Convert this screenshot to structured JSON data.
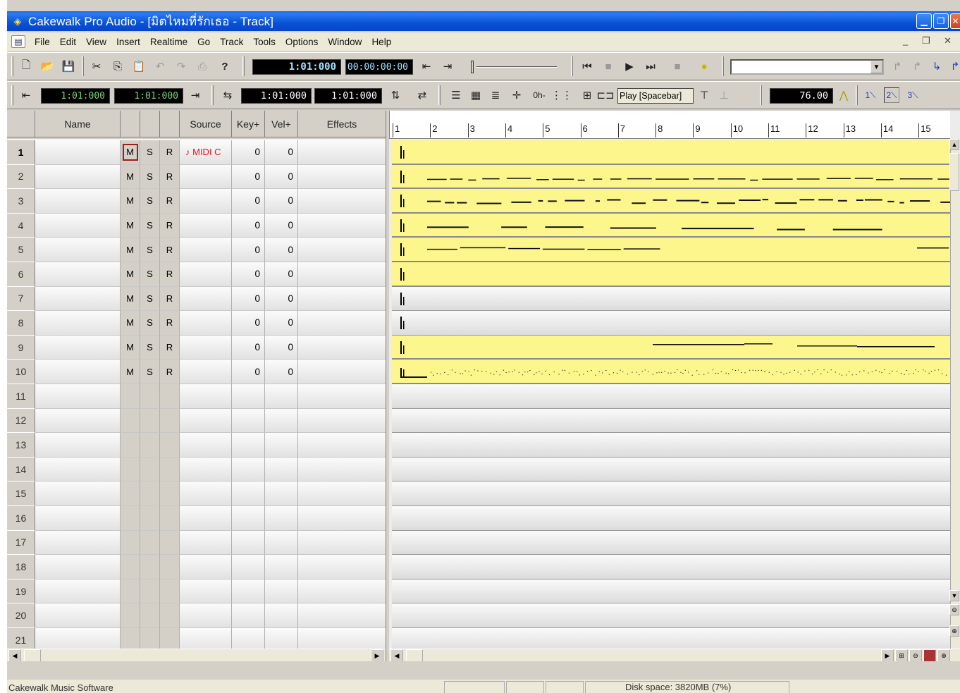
{
  "window": {
    "title": "Cakewalk Pro Audio - [มิตไหมที่รักเธอ - Track]",
    "app_icon": "cakewalk-icon",
    "controls": [
      "minimize",
      "restore",
      "close"
    ]
  },
  "menu": {
    "items": [
      "File",
      "Edit",
      "View",
      "Insert",
      "Realtime",
      "Go",
      "Track",
      "Tools",
      "Options",
      "Window",
      "Help"
    ],
    "mdi_controls": "_ ̅□ ×"
  },
  "toolbar1": {
    "now_time_mbt": "1:01:000",
    "now_time_smpte": "00:00:00:00",
    "combo_value": "",
    "icons": [
      "new-icon",
      "open-icon",
      "save-icon",
      "cut-icon",
      "copy-icon",
      "paste-icon",
      "undo-icon",
      "redo-icon",
      "print-icon",
      "help-icon",
      "rewind-to-start-icon",
      "stop-icon",
      "play-icon",
      "go-to-end-icon",
      "record-icon",
      "panic-icon"
    ]
  },
  "toolbar2": {
    "from_time": "1:01:000",
    "thru_time": "1:01:000",
    "loop_start": "1:01:000",
    "loop_end": "1:01:000",
    "play_label": "Play [Spacebar]",
    "tempo": "76.00",
    "meter_labels": [
      "1",
      "2",
      "3"
    ]
  },
  "columns": {
    "name": "Name",
    "source": "Source",
    "key": "Key+",
    "vel": "Vel+",
    "effects": "Effects"
  },
  "tracks": [
    {
      "num": "1",
      "m": "M",
      "s": "S",
      "r": "R",
      "source": "♪ MIDI C",
      "key": "0",
      "vel": "0"
    },
    {
      "num": "2",
      "m": "M",
      "s": "S",
      "r": "R",
      "source": "",
      "key": "0",
      "vel": "0"
    },
    {
      "num": "3",
      "m": "M",
      "s": "S",
      "r": "R",
      "source": "",
      "key": "0",
      "vel": "0"
    },
    {
      "num": "4",
      "m": "M",
      "s": "S",
      "r": "R",
      "source": "",
      "key": "0",
      "vel": "0"
    },
    {
      "num": "5",
      "m": "M",
      "s": "S",
      "r": "R",
      "source": "",
      "key": "0",
      "vel": "0"
    },
    {
      "num": "6",
      "m": "M",
      "s": "S",
      "r": "R",
      "source": "",
      "key": "0",
      "vel": "0"
    },
    {
      "num": "7",
      "m": "M",
      "s": "S",
      "r": "R",
      "source": "",
      "key": "0",
      "vel": "0"
    },
    {
      "num": "8",
      "m": "M",
      "s": "S",
      "r": "R",
      "source": "",
      "key": "0",
      "vel": "0"
    },
    {
      "num": "9",
      "m": "M",
      "s": "S",
      "r": "R",
      "source": "",
      "key": "0",
      "vel": "0"
    },
    {
      "num": "10",
      "m": "M",
      "s": "S",
      "r": "R",
      "source": "",
      "key": "0",
      "vel": "0"
    },
    {
      "num": "11"
    },
    {
      "num": "12"
    },
    {
      "num": "13"
    },
    {
      "num": "14"
    },
    {
      "num": "15"
    },
    {
      "num": "16"
    },
    {
      "num": "17"
    },
    {
      "num": "18"
    },
    {
      "num": "19"
    },
    {
      "num": "20"
    },
    {
      "num": "21"
    }
  ],
  "ruler": {
    "measures": [
      "1",
      "2",
      "3",
      "4",
      "5",
      "6",
      "7",
      "8",
      "9",
      "10",
      "11",
      "12",
      "13",
      "14",
      "15"
    ]
  },
  "clip_lanes_filled": [
    true,
    true,
    true,
    true,
    true,
    true,
    false,
    false,
    true,
    true
  ],
  "statusbar": {
    "left_text": "Cakewalk Music Software",
    "disk_space": "Disk space: 3820MB (7%)"
  },
  "colors": {
    "title_blue": "#0852d8",
    "clip_yellow": "#fcf68d",
    "mute_highlight": "#9b1f1f",
    "source_red": "#e2141c"
  }
}
